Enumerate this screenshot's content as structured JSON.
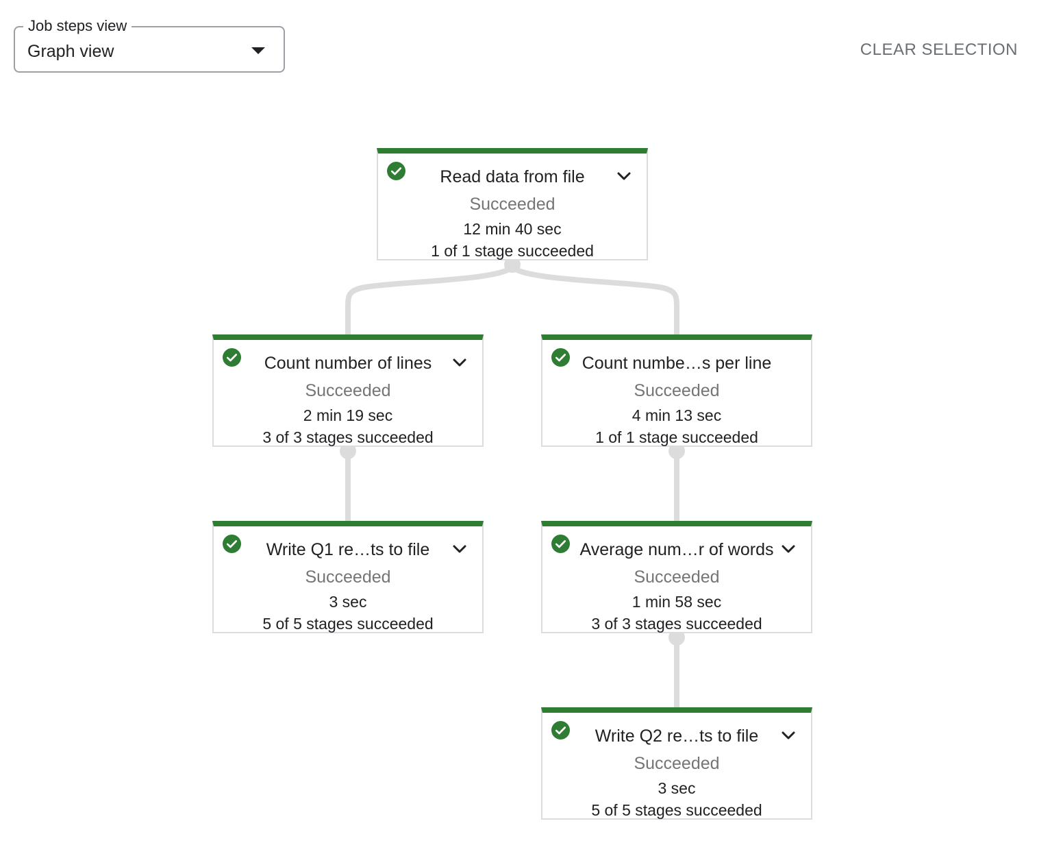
{
  "job_steps_view": {
    "label": "Job steps view",
    "selected": "Graph view"
  },
  "clear_selection_label": "CLEAR SELECTION",
  "colors": {
    "success_green": "#2e7d32",
    "edge_gray": "#dcdcdc",
    "muted_text": "#757575"
  },
  "steps": [
    {
      "title": "Read data from file",
      "status": "Succeeded",
      "duration": "12 min 40 sec",
      "stages": "1 of 1 stage succeeded"
    },
    {
      "title": "Count number of lines",
      "status": "Succeeded",
      "duration": "2 min 19 sec",
      "stages": "3 of 3 stages succeeded"
    },
    {
      "title": "Count numbe…s per line",
      "status": "Succeeded",
      "duration": "4 min 13 sec",
      "stages": "1 of 1 stage succeeded"
    },
    {
      "title": "Write Q1 re…ts to file",
      "status": "Succeeded",
      "duration": "3 sec",
      "stages": "5 of 5 stages succeeded"
    },
    {
      "title": "Average num…r of words",
      "status": "Succeeded",
      "duration": "1 min 58 sec",
      "stages": "3 of 3 stages succeeded"
    },
    {
      "title": "Write Q2 re…ts to file",
      "status": "Succeeded",
      "duration": "3 sec",
      "stages": "5 of 5 stages succeeded"
    }
  ]
}
